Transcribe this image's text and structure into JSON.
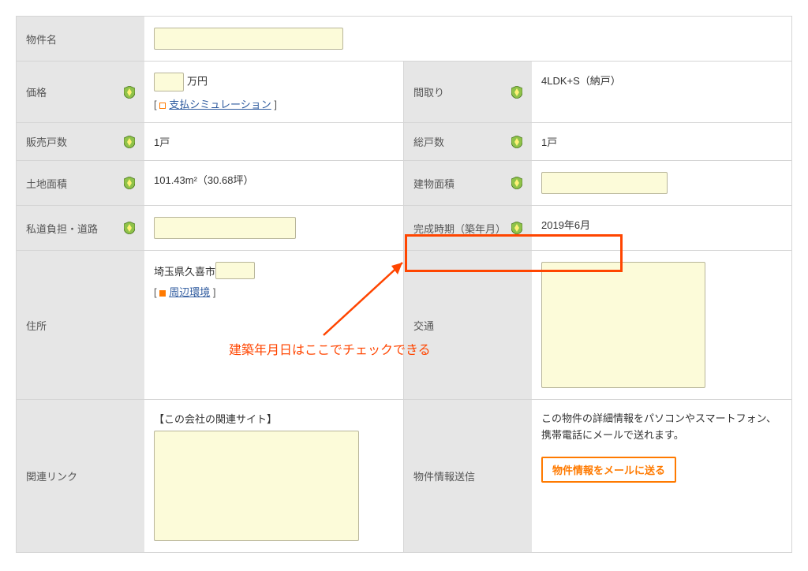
{
  "rows": {
    "name": {
      "label": "物件名"
    },
    "price": {
      "label": "価格",
      "unit": "万円",
      "simLink": "支払シミュレーション"
    },
    "layout": {
      "label": "間取り",
      "value": "4LDK+S（納戸）"
    },
    "salesUnits": {
      "label": "販売戸数",
      "value": "1戸"
    },
    "totalUnits": {
      "label": "総戸数",
      "value": "1戸"
    },
    "landArea": {
      "label": "土地面積",
      "value": "101.43m²（30.68坪）"
    },
    "buildingArea": {
      "label": "建物面積"
    },
    "privateRoad": {
      "label": "私道負担・道路"
    },
    "completion": {
      "label": "完成時期（築年月）",
      "value": "2019年6月"
    },
    "address": {
      "label": "住所",
      "prefix": "埼玉県久喜市",
      "envLink": "周辺環境"
    },
    "transport": {
      "label": "交通"
    },
    "related": {
      "label": "関連リンク",
      "heading": "【この会社の関連サイト】"
    },
    "infoSend": {
      "label": "物件情報送信",
      "desc": "この物件の詳細情報をパソコンやスマートフォン、携帯電話にメールで送れます。",
      "btn": "物件情報をメールに送る"
    }
  },
  "annotation": "建築年月日はここでチェックできる"
}
